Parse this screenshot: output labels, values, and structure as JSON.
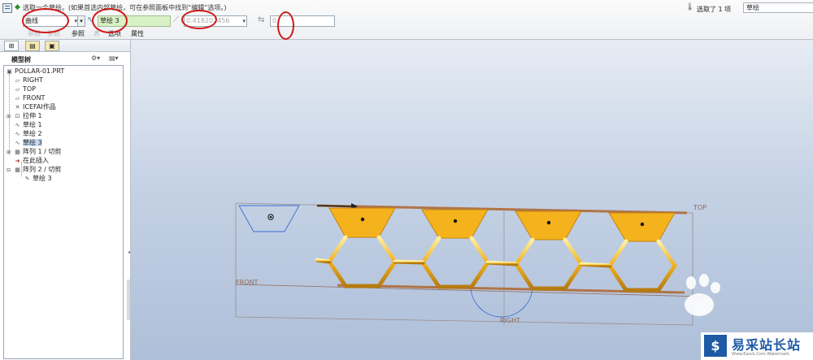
{
  "dashboard": {
    "prompt": "选取一个草绘。(如果首选内部草绘，可在参照面板中找到“编辑”选项。)",
    "selected_count": "选取了 1 项",
    "filter_value": "草绘",
    "type_value": "曲线",
    "sketch_value": "草绘 3",
    "value_field": "0.418202456",
    "num_field": "0",
    "tabs": [
      "参照",
      "参照",
      "参照",
      "表",
      "选项",
      "属性"
    ]
  },
  "navigator": {
    "title": "模型树",
    "items": [
      {
        "label": "POLLAR-01.PRT",
        "icon": "part"
      },
      {
        "label": "RIGHT",
        "icon": "datum-plane"
      },
      {
        "label": "TOP",
        "icon": "datum-plane"
      },
      {
        "label": "FRONT",
        "icon": "datum-plane"
      },
      {
        "label": "ICEFAI作品",
        "icon": "csys"
      },
      {
        "label": "拉伸 1",
        "icon": "extrude"
      },
      {
        "label": "草绘 1",
        "icon": "sketch"
      },
      {
        "label": "草绘 2",
        "icon": "sketch"
      },
      {
        "label": "草绘 3",
        "icon": "sketch"
      },
      {
        "label": "阵列 1 / 切剪",
        "icon": "pattern"
      },
      {
        "label": "在此插入",
        "icon": "insert-here"
      },
      {
        "label": "阵列 2 / 切剪",
        "icon": "pattern"
      },
      {
        "label": "草绘 3",
        "icon": "sketch-edit"
      }
    ]
  },
  "graphics": {
    "datum_top": "TOP",
    "datum_front": "FRONT",
    "datum_right": "RIGHT"
  },
  "watermark": {
    "title": "易采站长站",
    "sub": "Www.Easck.Com Watermark"
  },
  "colors": {
    "highlight_oval": "#d01818",
    "honeycomb": "#f0b020",
    "sketch_field": "#d8f1c6"
  }
}
